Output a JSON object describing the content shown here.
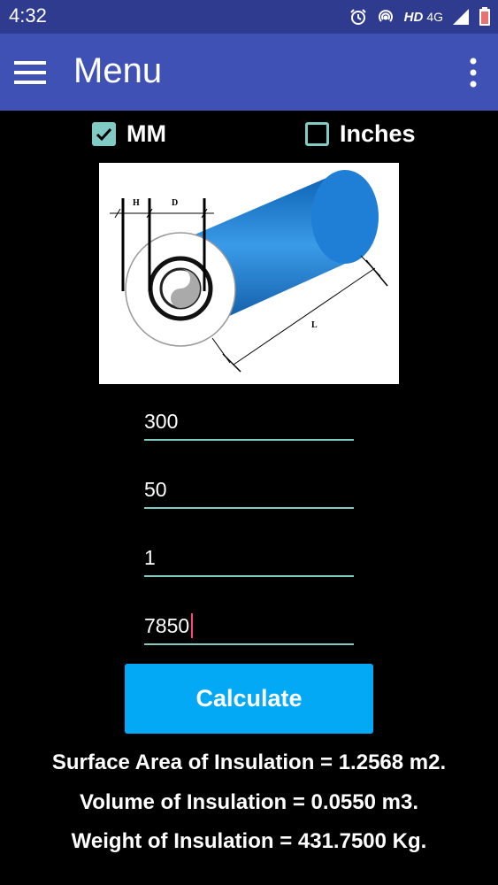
{
  "status_bar": {
    "time": "4:32",
    "network_label": "HD",
    "network_type": "4G",
    "icons": [
      "alarm-icon",
      "hotspot-icon",
      "signal-icon",
      "battery-icon"
    ]
  },
  "app_bar": {
    "title": "Menu",
    "color": "#3f51b5",
    "status_color": "#2f3b8f"
  },
  "units": {
    "mm": {
      "label": "MM",
      "checked": true
    },
    "inches": {
      "label": "Inches",
      "checked": false
    }
  },
  "diagram": {
    "labels": {
      "h": "H",
      "d": "D",
      "l": "L"
    }
  },
  "inputs": [
    {
      "value": "300"
    },
    {
      "value": "50"
    },
    {
      "value": "1"
    },
    {
      "value": "7850",
      "focused": true
    }
  ],
  "calculate_label": "Calculate",
  "results": {
    "surface_area": "Surface Area of Insulation = 1.2568 m2.",
    "volume": "Volume of Insulation = 0.0550 m3.",
    "weight": "Weight of Insulation = 431.7500 Kg."
  },
  "colors": {
    "accent": "#80cbc4",
    "button": "#03a9f4",
    "cursor": "#ff4081",
    "pipe": "#0d6fc5"
  }
}
